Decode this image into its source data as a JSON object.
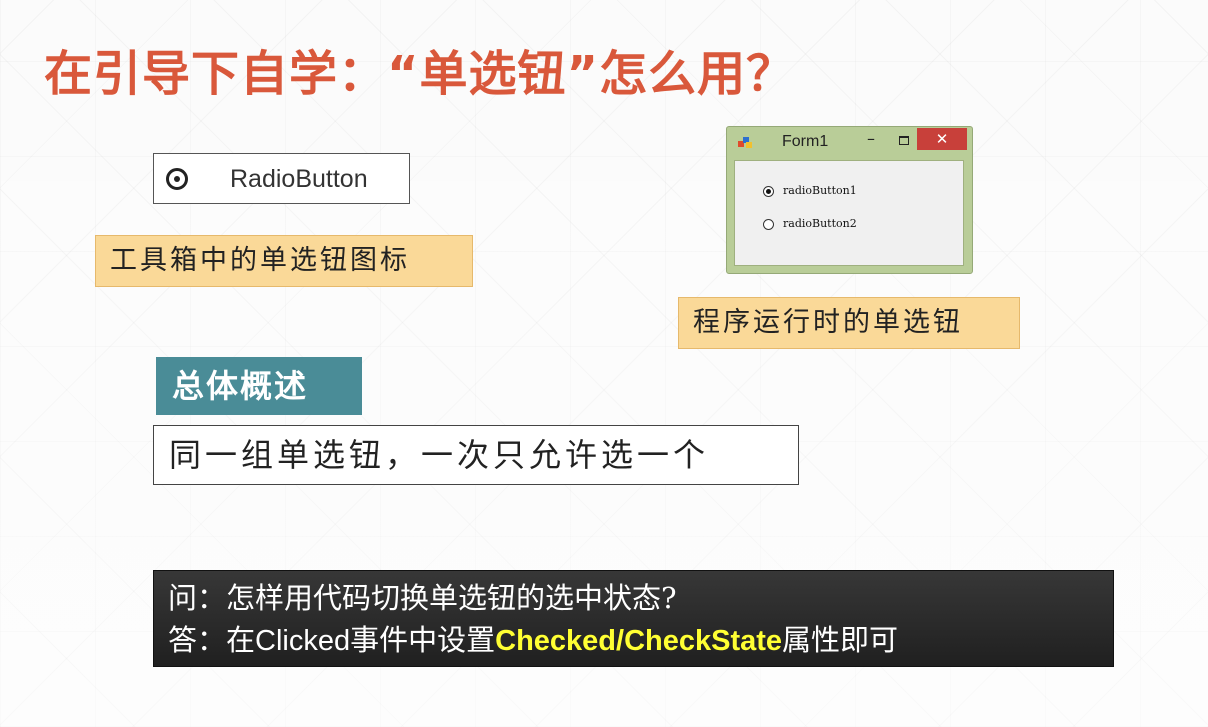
{
  "slide": {
    "title": "在引导下自学：“单选钮”怎么用？",
    "accent_color": "#d9583b"
  },
  "toolbox": {
    "item_label": "RadioButton",
    "icon": "radio-button-icon",
    "caption": "工具箱中的单选钮图标"
  },
  "form_window": {
    "title": "Form1",
    "minimize_symbol": "–",
    "close_symbol": "✕",
    "radio_buttons": [
      {
        "label": "radioButton1",
        "checked": true
      },
      {
        "label": "radioButton2",
        "checked": false
      }
    ],
    "caption": "程序运行时的单选钮"
  },
  "overview": {
    "heading": "总体概述",
    "text": "同一组单选钮，一次只允许选一个"
  },
  "qa": {
    "question": "问：怎样用代码切换单选钮的选中状态?",
    "answer_prefix": "答：在",
    "answer_event": "Clicked",
    "answer_mid": "事件中设置",
    "answer_highlight": "Checked/CheckState",
    "answer_suffix": "属性即可",
    "highlight_color": "#ffff33"
  }
}
